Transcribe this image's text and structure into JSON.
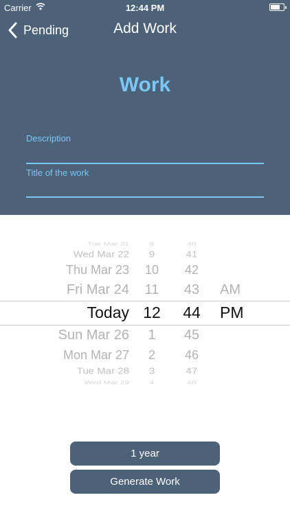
{
  "status_bar": {
    "carrier": "Carrier",
    "time": "12:44 PM"
  },
  "nav": {
    "back_label": "Pending",
    "title": "Add Work"
  },
  "form": {
    "section_title": "Work",
    "description_label": "Description",
    "title_label": "Title of the work"
  },
  "picker": {
    "rows": [
      {
        "date": "Tue Mar 21",
        "hour": "8",
        "minute": "40",
        "period": ""
      },
      {
        "date": "Wed Mar 22",
        "hour": "9",
        "minute": "41",
        "period": ""
      },
      {
        "date": "Thu Mar 23",
        "hour": "10",
        "minute": "42",
        "period": ""
      },
      {
        "date": "Fri Mar 24",
        "hour": "11",
        "minute": "43",
        "period": "AM"
      },
      {
        "date": "Today",
        "hour": "12",
        "minute": "44",
        "period": "PM"
      },
      {
        "date": "Sun Mar 26",
        "hour": "1",
        "minute": "45",
        "period": ""
      },
      {
        "date": "Mon Mar 27",
        "hour": "2",
        "minute": "46",
        "period": ""
      },
      {
        "date": "Tue Mar 28",
        "hour": "3",
        "minute": "47",
        "period": ""
      },
      {
        "date": "Wed Mar 29",
        "hour": "4",
        "minute": "48",
        "period": ""
      }
    ]
  },
  "buttons": {
    "duration_label": "1 year",
    "generate_label": "Generate Work"
  }
}
